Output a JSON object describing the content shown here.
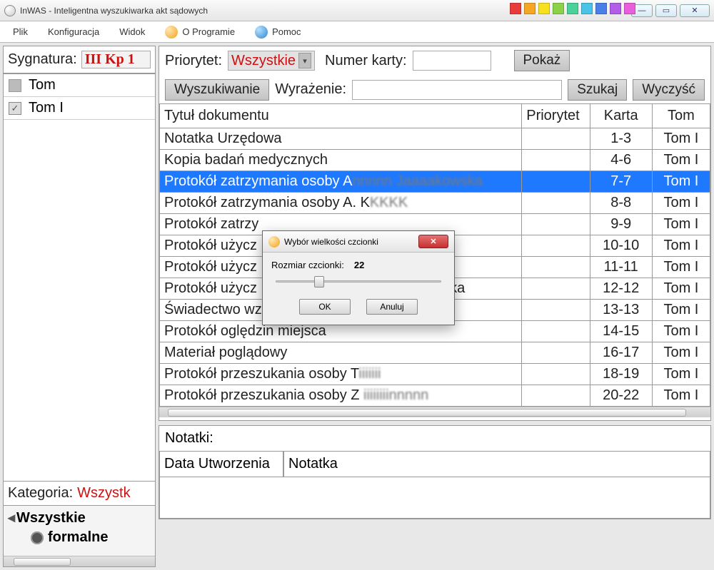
{
  "window": {
    "title": "InWAS - Inteligentna wyszukiwarka akt sądowych"
  },
  "menu": {
    "file": "Plik",
    "config": "Konfiguracja",
    "view": "Widok",
    "about": "O Programie",
    "help": "Pomoc"
  },
  "palette": [
    "#ea3b3b",
    "#f5a623",
    "#f7e01e",
    "#8bd24a",
    "#4ad29a",
    "#4ac3e8",
    "#4a7fe8",
    "#b15ee8",
    "#e85edb"
  ],
  "left": {
    "sig_label": "Sygnatura:",
    "sig_value": "III Kp 1",
    "tom_header": "Tom",
    "toms": [
      {
        "checked": true,
        "name": "Tom I"
      }
    ],
    "kat_label": "Kategoria:",
    "kat_value": "Wszystk",
    "tree_all": "Wszystkie",
    "tree_item1": "formalne"
  },
  "toolbar": {
    "prio_label": "Priorytet:",
    "prio_value": "Wszystkie",
    "card_label": "Numer karty:",
    "show_btn": "Pokaż",
    "search_toggle": "Wyszukiwanie",
    "expr_label": "Wyrażenie:",
    "search_btn": "Szukaj",
    "clear_btn": "Wyczyść"
  },
  "grid": {
    "cols": {
      "title": "Tytuł dokumentu",
      "prio": "Priorytet",
      "card": "Karta",
      "tom": "Tom"
    },
    "rows": [
      {
        "title": "Notatka Urzędowa",
        "prio": "",
        "card": "1-3",
        "tom": "Tom I",
        "sel": false
      },
      {
        "title": "Kopia badań medycznych",
        "prio": "",
        "card": "4-6",
        "tom": "Tom I",
        "sel": false
      },
      {
        "title": "Protokół zatrzymania osoby A",
        "title_blur": "nnnnn Jaaaakowska",
        "prio": "",
        "card": "7-7",
        "tom": "Tom I",
        "sel": true
      },
      {
        "title": "Protokół zatrzymania osoby A. K",
        "title_blur": "KKKK",
        "prio": "",
        "card": "8-8",
        "tom": "Tom I",
        "sel": false
      },
      {
        "title": "Protokół zatrzy",
        "prio": "",
        "card": "9-9",
        "tom": "Tom I",
        "sel": false
      },
      {
        "title": "Protokół użycz",
        "prio": "",
        "card": "10-10",
        "tom": "Tom I",
        "sel": false
      },
      {
        "title": "Protokół użycz",
        "prio": "",
        "card": "11-11",
        "tom": "Tom I",
        "sel": false
      },
      {
        "title": "Protokół użycz",
        "title_tail": "ka",
        "prio": "",
        "card": "12-12",
        "tom": "Tom I",
        "sel": false
      },
      {
        "title": "Świadectwo wz",
        "prio": "",
        "card": "13-13",
        "tom": "Tom I",
        "sel": false
      },
      {
        "title": "Protokół oględzin miejsca",
        "prio": "",
        "card": "14-15",
        "tom": "Tom I",
        "sel": false
      },
      {
        "title": "Materiał poglądowy",
        "prio": "",
        "card": "16-17",
        "tom": "Tom I",
        "sel": false
      },
      {
        "title": "Protokół przeszukania osoby T",
        "title_blur": "iiiiiii",
        "prio": "",
        "card": "18-19",
        "tom": "Tom I",
        "sel": false
      },
      {
        "title": "Protokół przeszukania osoby Z",
        "title_blur": " iiiiiiiinnnnn",
        "prio": "",
        "card": "20-22",
        "tom": "Tom I",
        "sel": false
      }
    ]
  },
  "notes": {
    "header": "Notatki:",
    "col_date": "Data Utworzenia",
    "col_note": "Notatka"
  },
  "dialog": {
    "title": "Wybór wielkości czcionki",
    "size_label": "Rozmiar czcionki:",
    "size_value": "22",
    "ok": "OK",
    "cancel": "Anuluj"
  }
}
